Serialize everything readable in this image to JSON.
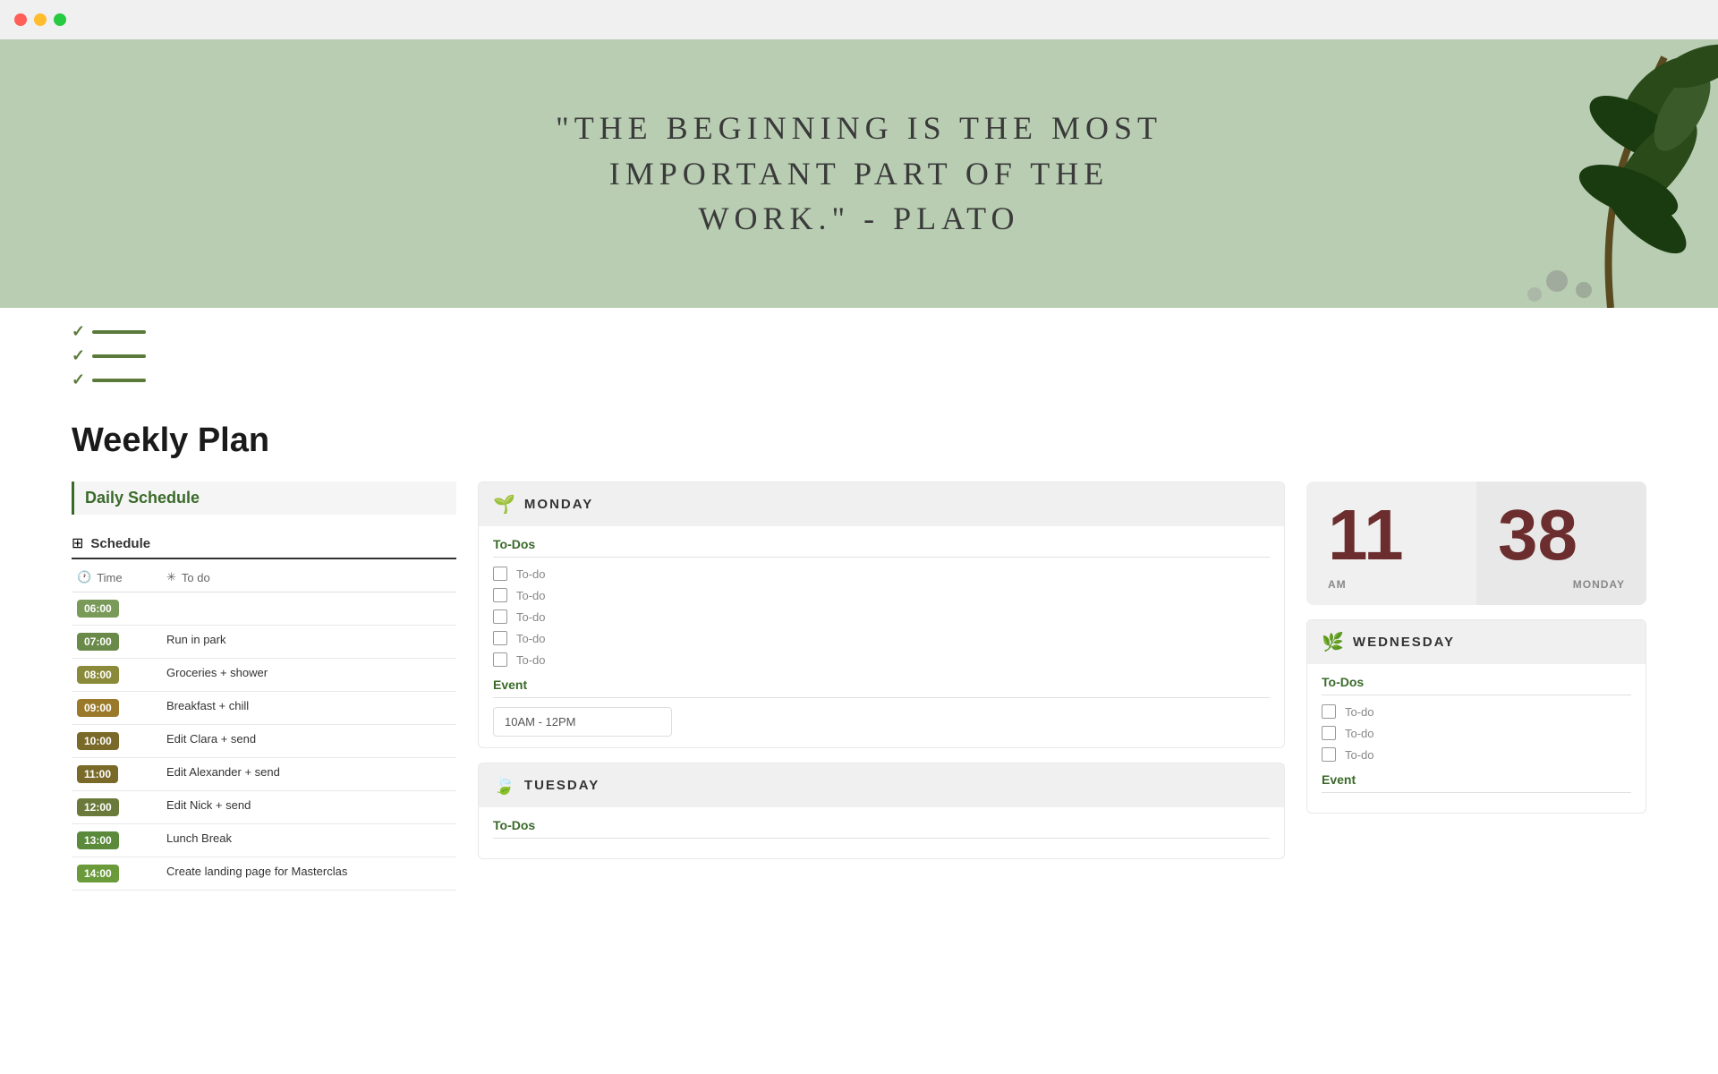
{
  "titlebar": {
    "dots": [
      "red",
      "yellow",
      "green"
    ]
  },
  "hero": {
    "quote_line1": "\"The Beginning Is The Most",
    "quote_line2": "Important Part Of The",
    "quote_line3": "Work.\" - Plato"
  },
  "page": {
    "title": "Weekly Plan"
  },
  "left_col": {
    "section_title": "Daily Schedule",
    "schedule_label": "Schedule",
    "col_time": "Time",
    "col_todo": "To do",
    "rows": [
      {
        "time": "06:00",
        "task": "",
        "color": "t-600"
      },
      {
        "time": "07:00",
        "task": "Run in park",
        "color": "t-700"
      },
      {
        "time": "08:00",
        "task": "Groceries + shower",
        "color": "t-800"
      },
      {
        "time": "09:00",
        "task": "Breakfast + chill",
        "color": "t-900"
      },
      {
        "time": "10:00",
        "task": "Edit Clara + send",
        "color": "t-1000"
      },
      {
        "time": "11:00",
        "task": "Edit Alexander + send",
        "color": "t-1100"
      },
      {
        "time": "12:00",
        "task": "Edit Nick + send",
        "color": "t-1200"
      },
      {
        "time": "13:00",
        "task": "Lunch Break",
        "color": "t-1300"
      },
      {
        "time": "14:00",
        "task": "Create landing page for Masterclas",
        "color": "t-1400"
      }
    ]
  },
  "monday": {
    "name": "MONDAY",
    "icon": "🌱",
    "todos_label": "To-Dos",
    "todos": [
      "To-do",
      "To-do",
      "To-do",
      "To-do",
      "To-do"
    ],
    "event_label": "Event",
    "event_time": "10AM - 12PM"
  },
  "tuesday": {
    "name": "TUESDAY",
    "icon": "🍃",
    "todos_label": "To-Dos"
  },
  "wednesday": {
    "name": "WEDNESDAY",
    "icon": "🌿",
    "todos_label": "To-Dos",
    "todos": [
      "To-do",
      "To-do",
      "To-do"
    ],
    "event_label": "Event"
  },
  "clock": {
    "hour": "11",
    "minute": "38",
    "period": "AM",
    "day": "MONDAY"
  }
}
